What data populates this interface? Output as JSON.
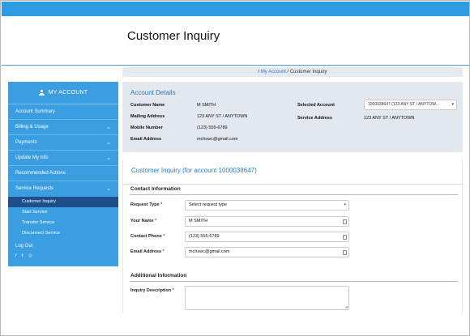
{
  "header": {
    "title": "Customer Inquiry"
  },
  "breadcrumb": {
    "sep1": "/ ",
    "link": "My Account",
    "sep2": " / ",
    "current": "Customer Inquiry"
  },
  "sidebar": {
    "account_label": "MY ACCOUNT",
    "items": [
      {
        "label": "Account Summary",
        "chevron": false
      },
      {
        "label": "Billing & Usage",
        "chevron": true
      },
      {
        "label": "Payments",
        "chevron": true
      },
      {
        "label": "Update My Info",
        "chevron": true
      },
      {
        "label": "Recommended Actions",
        "chevron": false
      },
      {
        "label": "Service Requests",
        "chevron": true
      }
    ],
    "sub_items": [
      {
        "label": "Customer Inquiry",
        "active": true
      },
      {
        "label": "Start Service",
        "active": false
      },
      {
        "label": "Transfer Service",
        "active": false
      },
      {
        "label": "Disconnect Service",
        "active": false
      }
    ],
    "logout": "Log Out",
    "social": {
      "facebook": "f",
      "twitter": "𝕥",
      "instagram": "◎"
    },
    "chevron_glyph": "⌄"
  },
  "account_details": {
    "title": "Account Details",
    "customer_name_label": "Customer Name",
    "customer_name": "M SMITH",
    "mailing_address_label": "Mailing Address",
    "mailing_address": "123 ANY ST / ANYTOWN",
    "mobile_number_label": "Mobile Number",
    "mobile_number": "(123) 555-6789",
    "email_label": "Email Address",
    "email": "mchswc@gmail.com",
    "selected_account_label": "Selected Account",
    "selected_account": "1000038647 (123 ANY ST / ANYTOW...",
    "service_address_label": "Service Address",
    "service_address": "123 ANY ST / ANYTOWN"
  },
  "inquiry_form": {
    "title": "Customer Inquiry (for account 1000038647)",
    "contact_section": "Contact Information",
    "request_type_label": "Request Type",
    "request_type_placeholder": "Select request type",
    "name_label": "Your Name",
    "name_value": "M SMITH",
    "phone_label": "Contact Phone",
    "phone_value": "(123) 555-6789",
    "email_label": "Email Address",
    "email_value": "mchswc@gmail.com",
    "additional_section": "Additional Information",
    "description_label": "Inquiry Description",
    "required_marker": " *"
  },
  "colors": {
    "accent": "#2f9be0",
    "sidebar": "#3a9ee0",
    "active_sub": "#1f4f8a",
    "panel": "#e2e8ee"
  }
}
